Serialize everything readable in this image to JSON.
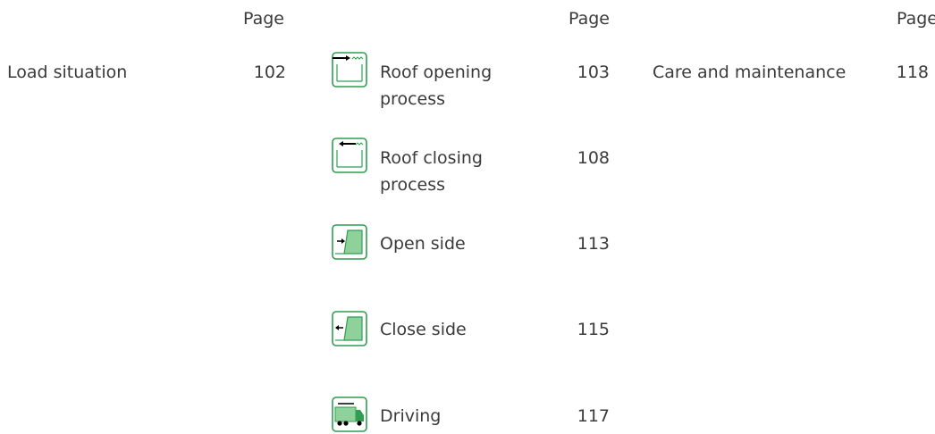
{
  "columns": [
    {
      "page_header": "Page"
    },
    {
      "page_header": "Page"
    },
    {
      "page_header": "Page"
    }
  ],
  "left": {
    "items": [
      {
        "label": "Load situation",
        "page": "102"
      }
    ]
  },
  "middle": {
    "items": [
      {
        "label": "Roof opening process",
        "page": "103",
        "icon": "roof-opening-icon"
      },
      {
        "label": "Roof closing process",
        "page": "108",
        "icon": "roof-closing-icon"
      },
      {
        "label": "Open side",
        "page": "113",
        "icon": "open-side-icon"
      },
      {
        "label": "Close side",
        "page": "115",
        "icon": "close-side-icon"
      },
      {
        "label": "Driving",
        "page": "117",
        "icon": "truck-driving-icon"
      }
    ]
  },
  "right": {
    "items": [
      {
        "label": "Care and maintenance",
        "page": "118"
      }
    ]
  },
  "colors": {
    "icon_green": "#2f9e52",
    "icon_fill": "#8fd19a",
    "text": "#3a3a3a"
  }
}
